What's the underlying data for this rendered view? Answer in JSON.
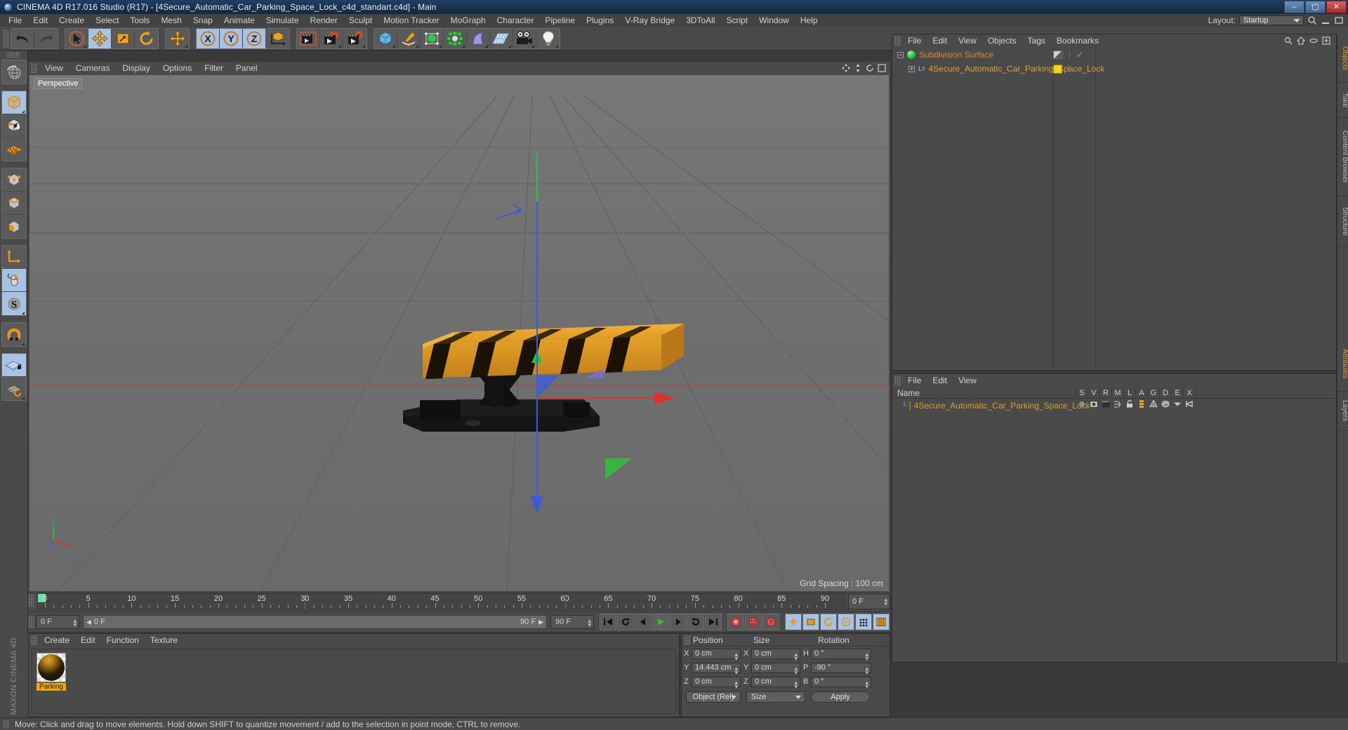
{
  "window": {
    "title": "CINEMA 4D R17.016 Studio (R17) - [4Secure_Automatic_Car_Parking_Space_Lock_c4d_standart.c4d] - Main",
    "minimize": "–",
    "maximize": "▢",
    "close": "✕"
  },
  "menubar": {
    "items": [
      "File",
      "Edit",
      "Create",
      "Select",
      "Tools",
      "Mesh",
      "Snap",
      "Animate",
      "Simulate",
      "Render",
      "Sculpt",
      "Motion Tracker",
      "MoGraph",
      "Character",
      "Pipeline",
      "Plugins",
      "V-Ray Bridge",
      "3DToAll",
      "Script",
      "Window",
      "Help"
    ],
    "layout_label": "Layout:",
    "layout_value": "Startup"
  },
  "toolbar": {
    "groups": [
      {
        "buttons": [
          {
            "name": "undo-button",
            "icon": "undo",
            "selected": false,
            "corner": false
          },
          {
            "name": "redo-button",
            "icon": "redo",
            "selected": false,
            "corner": false
          }
        ]
      },
      {
        "buttons": [
          {
            "name": "live-selection-tool",
            "icon": "cursor-circle",
            "selected": false,
            "corner": true
          },
          {
            "name": "move-tool",
            "icon": "move-arrows",
            "selected": true,
            "corner": false
          },
          {
            "name": "scale-tool",
            "icon": "scale-box",
            "selected": false,
            "corner": false
          },
          {
            "name": "rotate-tool",
            "icon": "rotate-arrows",
            "selected": false,
            "corner": false
          }
        ]
      },
      {
        "buttons": [
          {
            "name": "move-duplicate-tool",
            "icon": "move-arrows",
            "selected": false,
            "corner": true
          }
        ]
      },
      {
        "buttons": [
          {
            "name": "axis-x-lock",
            "icon": "x-axis",
            "selected": true,
            "corner": false
          },
          {
            "name": "axis-y-lock",
            "icon": "y-axis",
            "selected": true,
            "corner": false
          },
          {
            "name": "axis-z-lock",
            "icon": "z-axis",
            "selected": true,
            "corner": false
          },
          {
            "name": "world-object-coordinates",
            "icon": "world-axis-cube",
            "selected": false,
            "corner": false
          }
        ]
      },
      {
        "buttons": [
          {
            "name": "render-view-button",
            "icon": "clapper",
            "selected": false,
            "corner": false
          },
          {
            "name": "render-to-picture-viewer-button",
            "icon": "clapper-picture",
            "selected": false,
            "corner": true
          },
          {
            "name": "render-settings-button",
            "icon": "clapper-gear",
            "selected": false,
            "corner": true
          }
        ]
      },
      {
        "buttons": [
          {
            "name": "add-cube-button",
            "icon": "cube-blue",
            "selected": false,
            "corner": true
          },
          {
            "name": "add-spline-button",
            "icon": "pen-spline",
            "selected": false,
            "corner": true
          },
          {
            "name": "add-generator-button",
            "icon": "green-cube",
            "selected": false,
            "corner": true
          },
          {
            "name": "add-mograph-button",
            "icon": "green-cluster",
            "selected": false,
            "corner": true
          },
          {
            "name": "add-deformer-button",
            "icon": "bend-shape",
            "selected": false,
            "corner": true
          },
          {
            "name": "add-scene-object-button",
            "icon": "floor-grid",
            "selected": false,
            "corner": true
          },
          {
            "name": "add-camera-button",
            "icon": "camera",
            "selected": false,
            "corner": true
          },
          {
            "name": "add-light-button",
            "icon": "lightbulb",
            "selected": false,
            "corner": true
          }
        ]
      }
    ]
  },
  "lefttoolbar": {
    "groups": [
      {
        "buttons": [
          {
            "name": "undo-view-button",
            "icon": "globe-wire",
            "selected": false,
            "corner": false
          }
        ]
      },
      {
        "buttons": [
          {
            "name": "model-mode-button",
            "icon": "cube-orange-solid",
            "selected": true,
            "corner": true
          },
          {
            "name": "texture-mode-button",
            "icon": "cube-checker",
            "selected": false,
            "corner": false
          },
          {
            "name": "workplane-mode-button",
            "icon": "plane-dots",
            "selected": false,
            "corner": false
          }
        ]
      },
      {
        "buttons": [
          {
            "name": "points-mode-button",
            "icon": "cube-points",
            "selected": false,
            "corner": false
          },
          {
            "name": "edges-mode-button",
            "icon": "cube-edges",
            "selected": false,
            "corner": false
          },
          {
            "name": "polygons-mode-button",
            "icon": "cube-polys",
            "selected": false,
            "corner": false
          }
        ]
      },
      {
        "buttons": [
          {
            "name": "object-axis-button",
            "icon": "axis-L",
            "selected": false,
            "corner": false
          },
          {
            "name": "viewport-solo-button",
            "icon": "mouse",
            "selected": true,
            "corner": false
          },
          {
            "name": "enable-axis-button",
            "icon": "s-sphere",
            "selected": true,
            "corner": true
          }
        ]
      },
      {
        "buttons": [
          {
            "name": "magnet-tool-button",
            "icon": "magnet",
            "selected": false,
            "corner": true
          }
        ]
      },
      {
        "buttons": [
          {
            "name": "lock-workplane-button",
            "icon": "grid-lock",
            "selected": true,
            "corner": false
          },
          {
            "name": "workplane-rotate-button",
            "icon": "grid-rotate",
            "selected": false,
            "corner": true
          }
        ]
      }
    ]
  },
  "viewport": {
    "menu": [
      "View",
      "Cameras",
      "Display",
      "Options",
      "Filter",
      "Panel"
    ],
    "label": "Perspective",
    "grid_spacing": "Grid Spacing : 100 cm",
    "axis_labels": {
      "y": "Y",
      "x": "X",
      "z": "Z"
    }
  },
  "object_manager": {
    "menu": [
      "File",
      "Edit",
      "View",
      "Objects",
      "Tags",
      "Bookmarks"
    ],
    "rows": [
      {
        "name": "Subdivision Surface",
        "color": "#d68a2e",
        "dot": "#39d45a",
        "depth": 0,
        "expander": "−",
        "enabled": true
      },
      {
        "name": "4Secure_Automatic_Car_Parking_Space_Lock",
        "color": "#d7a02a",
        "dot": "#f0d41e",
        "depth": 1,
        "expander": "+",
        "enabled": true
      }
    ]
  },
  "attribute_manager": {
    "menu": [
      "File",
      "Edit",
      "View"
    ],
    "name_column": "Name",
    "columns": [
      "S",
      "V",
      "R",
      "M",
      "L",
      "A",
      "G",
      "D",
      "E",
      "X"
    ],
    "rows": [
      {
        "name": "4Secure_Automatic_Car_Parking_Space_Lock",
        "color": "#d7a02a",
        "swatch": "#f0d41e"
      }
    ]
  },
  "dock_tabs_right": [
    "Objects",
    "Take",
    "Content Browser",
    "Structure"
  ],
  "dock_tabs_right2": [
    "Attributes",
    "Layers"
  ],
  "timeline": {
    "ticks": [
      0,
      5,
      10,
      15,
      20,
      25,
      30,
      35,
      40,
      45,
      50,
      55,
      60,
      65,
      70,
      75,
      80,
      85,
      90
    ],
    "current_frame": "0 F",
    "start_frame": "0 F",
    "end_frame": "90 F",
    "preview_end": "90 F",
    "range_left": "0 F",
    "range_right": "90 F"
  },
  "transport": {
    "buttons": [
      {
        "name": "go-to-start-button",
        "icon": "skip-back"
      },
      {
        "name": "previous-keyframe-button",
        "icon": "prev-key"
      },
      {
        "name": "previous-frame-button",
        "icon": "prev-frame"
      },
      {
        "name": "play-button",
        "icon": "play"
      },
      {
        "name": "next-frame-button",
        "icon": "next-frame"
      },
      {
        "name": "next-keyframe-button",
        "icon": "next-key"
      },
      {
        "name": "go-to-end-button",
        "icon": "skip-forward"
      }
    ],
    "record_buttons": [
      {
        "name": "record-active-objects-button",
        "icon": "record"
      },
      {
        "name": "autokeying-button",
        "icon": "autokey"
      },
      {
        "name": "keyframe-selection-button",
        "icon": "key-select"
      }
    ],
    "key_toggles": [
      {
        "name": "position-key-toggle",
        "icon": "pos-key",
        "selected": true
      },
      {
        "name": "scale-key-toggle",
        "icon": "scale-key",
        "selected": true
      },
      {
        "name": "rotation-key-toggle",
        "icon": "rot-key",
        "selected": true
      },
      {
        "name": "param-key-toggle",
        "icon": "param-key",
        "selected": true
      },
      {
        "name": "pla-key-toggle",
        "icon": "pla-key",
        "selected": true
      },
      {
        "name": "timeline-toggle",
        "icon": "timeline",
        "selected": true
      }
    ]
  },
  "material_manager": {
    "menu": [
      "Create",
      "Edit",
      "Function",
      "Texture"
    ],
    "materials": [
      {
        "name": "Parking",
        "selected": true
      }
    ]
  },
  "coordinates": {
    "headers": {
      "position": "Position",
      "size": "Size",
      "rotation": "Rotation"
    },
    "position": {
      "x_label": "X",
      "x": "0 cm",
      "y_label": "Y",
      "y": "14.443 cm",
      "z_label": "Z",
      "z": "0 cm"
    },
    "size": {
      "x_label": "X",
      "x": "0 cm",
      "y_label": "Y",
      "y": "0 cm",
      "z_label": "Z",
      "z": "0 cm"
    },
    "rotation": {
      "h_label": "H",
      "h": "0 °",
      "p_label": "P",
      "p": "-90 °",
      "b_label": "B",
      "b": "0 °"
    },
    "coord_mode": "Object (Rel)",
    "size_mode": "Size",
    "apply": "Apply"
  },
  "statusbar": {
    "message": "Move: Click and drag to move elements. Hold down SHIFT to quantize movement / add to the selection in point mode, CTRL to remove."
  },
  "brand": "MAXON CINEMA 4D",
  "colors": {
    "panel_bg": "#4a4a4a",
    "viewport_bg": "#6f6f6f",
    "accent_selected": "#a8c2e6",
    "orange": "#e39a1e",
    "title_blue": "#1f3f63"
  }
}
